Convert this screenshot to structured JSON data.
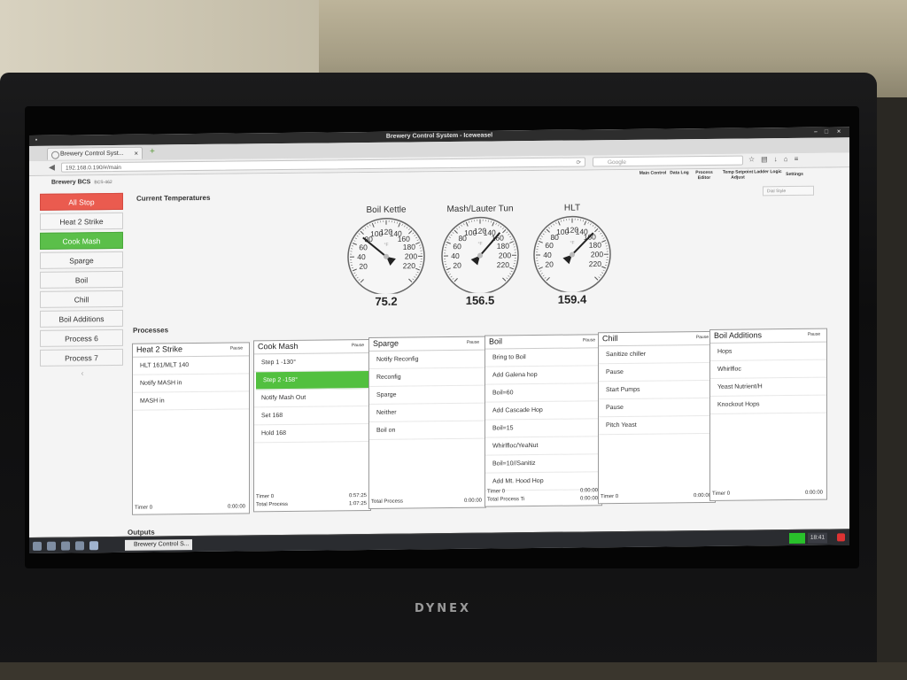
{
  "browser": {
    "window_title": "Brewery Control System - Iceweasel",
    "tab_title": "Brewery Control Syst...",
    "url": "192.168.0.190/#/main",
    "search_placeholder": "Google"
  },
  "app": {
    "brand": "Brewery BCS",
    "brand_sub": "BCS-462",
    "nav": [
      {
        "label": "Main Control"
      },
      {
        "label": "Data Log"
      },
      {
        "label": "Process Editor"
      },
      {
        "label": "Temp Setpoint Adjust"
      },
      {
        "label": "Ladder Logic"
      },
      {
        "label": "Settings"
      }
    ],
    "style_select": "Dial Style"
  },
  "sidebar": {
    "items": [
      {
        "label": "All Stop",
        "state": "stop"
      },
      {
        "label": "Heat 2 Strike",
        "state": "idle"
      },
      {
        "label": "Cook Mash",
        "state": "active"
      },
      {
        "label": "Sparge",
        "state": "idle"
      },
      {
        "label": "Boil",
        "state": "idle"
      },
      {
        "label": "Chill",
        "state": "idle"
      },
      {
        "label": "Boil Additions",
        "state": "idle"
      },
      {
        "label": "Process 6",
        "state": "idle"
      },
      {
        "label": "Process 7",
        "state": "idle"
      }
    ],
    "collapse_glyph": "‹"
  },
  "temperatures": {
    "heading": "Current Temperatures",
    "scale_ticks": [
      "20",
      "40",
      "60",
      "80",
      "100",
      "120",
      "140",
      "160",
      "180",
      "200",
      "220"
    ],
    "unit_glyph": "°F",
    "gauges": [
      {
        "name": "Boil Kettle",
        "value": "75.2",
        "reading": 75.2
      },
      {
        "name": "Mash/Lauter Tun",
        "value": "156.5",
        "reading": 156.5
      },
      {
        "name": "HLT",
        "value": "159.4",
        "reading": 159.4
      }
    ]
  },
  "processes": {
    "heading": "Processes",
    "pause_label": "Pause",
    "cards": [
      {
        "title": "Heat 2 Strike",
        "steps": [
          "HLT 161/MLT 140",
          "Notify MASH in",
          "MASH in"
        ],
        "active_step": -1,
        "footer": [
          {
            "label": "Timer 0",
            "value": "0:00:00"
          }
        ]
      },
      {
        "title": "Cook Mash",
        "steps": [
          "Step 1 -130°",
          "Step 2 -158°",
          "Notify Mash Out",
          "Set 168",
          "Hold 168"
        ],
        "active_step": 1,
        "footer": [
          {
            "label": "Timer 0",
            "value": "0:57:25"
          },
          {
            "label": "Total Process",
            "value": "1:07:25"
          }
        ]
      },
      {
        "title": "Sparge",
        "steps": [
          "Notify Reconfig",
          "Reconfig",
          "Sparge",
          "Neither",
          "Boil on"
        ],
        "active_step": -1,
        "footer": [
          {
            "label": "Total Process",
            "value": "0:00:00"
          }
        ]
      },
      {
        "title": "Boil",
        "steps": [
          "Bring to Boil",
          "Add Galena hop",
          "Boil=60",
          "Add Cascade Hop",
          "Boil=15",
          "Whirlfloc/YeaNut",
          "Boil=10//Sanitiz",
          "Add Mt. Hood Hop"
        ],
        "active_step": -1,
        "footer": [
          {
            "label": "Timer 0",
            "value": "0:00:00"
          },
          {
            "label": "Total Process Ti",
            "value": "0:00:00"
          }
        ]
      },
      {
        "title": "Chill",
        "steps": [
          "Sanitize chiller",
          "Pause",
          "Start Pumps",
          "Pause",
          "Pitch Yeast"
        ],
        "active_step": -1,
        "footer": [
          {
            "label": "Timer 0",
            "value": "0:00:00"
          }
        ]
      },
      {
        "title": "Boil Additions",
        "steps": [
          "Hops",
          "Whirlfloc",
          "Yeast Nutrient/H",
          "Knockout Hops"
        ],
        "active_step": -1,
        "footer": [
          {
            "label": "Timer 0",
            "value": "0:00:00"
          }
        ]
      }
    ]
  },
  "outputs": {
    "heading": "Outputs"
  },
  "taskbar": {
    "app_label": "Brewery Control S...",
    "clock": "18:41"
  },
  "monitor": {
    "brand": "DYNEX"
  },
  "colors": {
    "stop": "#ea5b4f",
    "active": "#5bbf4a"
  }
}
